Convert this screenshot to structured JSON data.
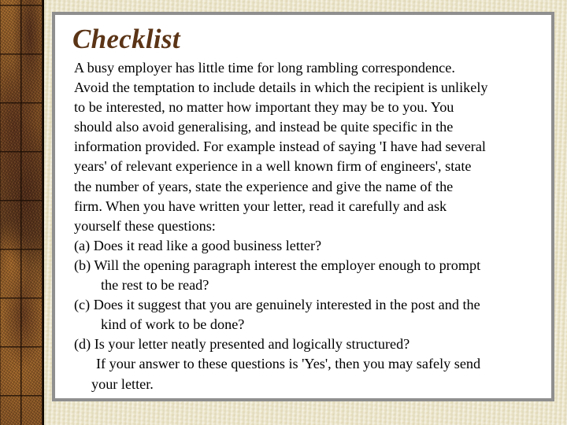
{
  "slide": {
    "title": "Checklist",
    "title_color": "#5b3416",
    "body_color": "#000000",
    "panel_background": "#ffffff",
    "panel_border_color": "#8f8f8f",
    "page_background": "#ebe3c3",
    "decor_strip_color": "#9c6327",
    "lines": [
      {
        "text": "A busy employer has little time for long rambling correspondence.",
        "indent": "none"
      },
      {
        "text": "Avoid the temptation to include details in which the recipient is unlikely",
        "indent": "none"
      },
      {
        "text": "to be interested, no matter how important they may be to you. You",
        "indent": "none"
      },
      {
        "text": "should also avoid generalising, and instead be quite specific in the",
        "indent": "none"
      },
      {
        "text": "information provided. For example instead of saying 'I have had several",
        "indent": "none"
      },
      {
        "text": "years' of relevant experience in a well known firm of engineers', state",
        "indent": "none"
      },
      {
        "text": "the number of years, state the experience and give the name of the",
        "indent": "none"
      },
      {
        "text": "firm. When you have written your letter, read it carefully and ask",
        "indent": "none"
      },
      {
        "text": "yourself these questions:",
        "indent": "none"
      },
      {
        "text": "(a) Does it read like a good business letter?",
        "indent": "none"
      },
      {
        "text": "(b) Will the opening paragraph interest the employer enough to prompt",
        "indent": "none"
      },
      {
        "text": "the rest to be read?",
        "indent": "large"
      },
      {
        "text": "(c) Does it suggest that you are genuinely interested in the post and the",
        "indent": "none"
      },
      {
        "text": "kind of work to be done?",
        "indent": "large"
      },
      {
        "text": "(d) Is your letter neatly presented and logically structured?",
        "indent": "none"
      },
      {
        "text": "If your answer to these questions is 'Yes', then you may safely send",
        "indent": "medium"
      },
      {
        "text": "your letter.",
        "indent": "small"
      }
    ]
  }
}
